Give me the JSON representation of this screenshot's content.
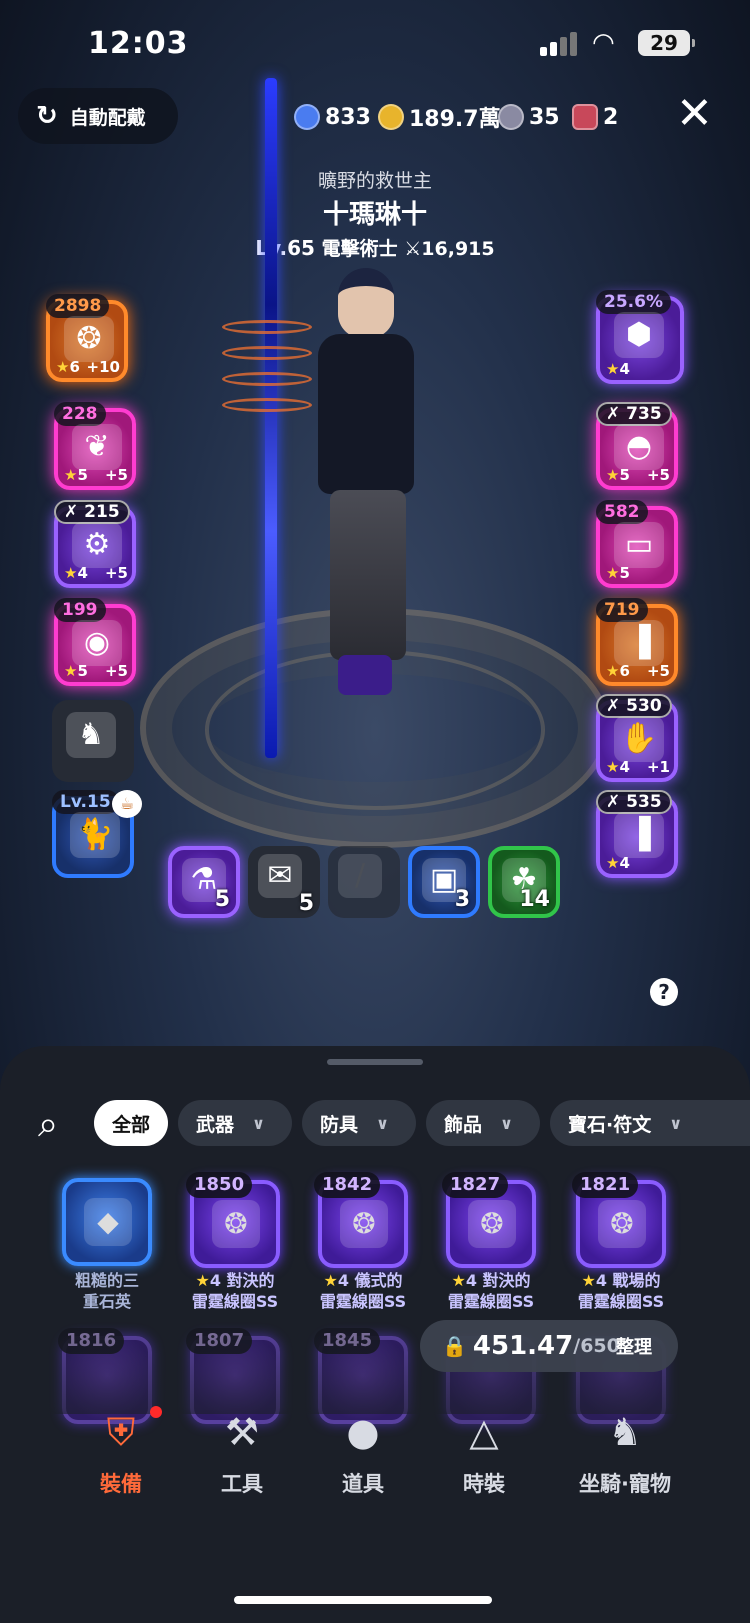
{
  "status_bar": {
    "time": "12:03",
    "battery": "29"
  },
  "top_bar": {
    "auto_equip_label": "自動配戴",
    "currencies": [
      {
        "icon": "blue-gem-icon",
        "value": "833",
        "color": "#5a8cff"
      },
      {
        "icon": "gold-coin-icon",
        "value": "189.7萬",
        "color": "#e8b42c"
      },
      {
        "icon": "silver-orb-icon",
        "value": "35",
        "color": "#a8a8c0"
      },
      {
        "icon": "demon-mask-icon",
        "value": "2",
        "color": "#d04050"
      }
    ],
    "close_label": "✕"
  },
  "character": {
    "title": "曠野的救世主",
    "name": "十瑪琳十",
    "level": "Lv.65",
    "class": "電擊術士",
    "power": "⚔16,915"
  },
  "left_slots": [
    {
      "badge": "2898",
      "stars": "6",
      "plus": "+10",
      "rarity": "orange",
      "icon": "claw-weapon-icon"
    },
    {
      "badge": "228",
      "stars": "5",
      "plus": "+5",
      "rarity": "pink",
      "icon": "necklace-icon"
    },
    {
      "badge": "✗ 215",
      "stars": "4",
      "plus": "+5",
      "rarity": "purple",
      "icon": "chain-necklace-icon"
    },
    {
      "badge": "199",
      "stars": "5",
      "plus": "+5",
      "rarity": "pink",
      "icon": "ring-icon"
    }
  ],
  "mount_slot": {
    "icon": "horse-icon"
  },
  "pet_slot": {
    "badge": "Lv.15",
    "icon": "cat-pet-icon"
  },
  "right_slots": [
    {
      "badge": "25.6%",
      "stars": "4",
      "plus": "",
      "rarity": "purple",
      "icon": "cube-icon"
    },
    {
      "badge": "✗ 735",
      "stars": "5",
      "plus": "+5",
      "rarity": "pink",
      "icon": "helmet-icon"
    },
    {
      "badge": "582",
      "stars": "5",
      "plus": "",
      "rarity": "pink",
      "icon": "armor-top-icon"
    },
    {
      "badge": "719",
      "stars": "6",
      "plus": "+5",
      "rarity": "orange",
      "icon": "armor-pants-icon"
    },
    {
      "badge": "✗ 530",
      "stars": "4",
      "plus": "+1",
      "rarity": "purple",
      "icon": "gloves-icon"
    },
    {
      "badge": "✗ 535",
      "stars": "4",
      "plus": "",
      "rarity": "purple",
      "icon": "boots-icon"
    }
  ],
  "quick_slots": [
    {
      "count": "5",
      "rarity": "purple",
      "icon": "red-potion-icon"
    },
    {
      "count": "5",
      "rarity": "dark",
      "icon": "scroll-icon"
    },
    {
      "count": "",
      "rarity": "dark",
      "icon": "empty-slot-icon"
    },
    {
      "count": "3",
      "rarity": "blue",
      "icon": "lantern-icon"
    },
    {
      "count": "14",
      "rarity": "green",
      "icon": "food-bag-icon"
    }
  ],
  "help_label": "?",
  "filter_chips": [
    {
      "label": "全部",
      "active": true
    },
    {
      "label": "武器",
      "active": false
    },
    {
      "label": "防具",
      "active": false
    },
    {
      "label": "飾品",
      "active": false
    },
    {
      "label": "寶石·符文",
      "active": false
    }
  ],
  "inventory_row1": [
    {
      "badge": "",
      "name1": "粗糙的三",
      "name2": "重石英",
      "star": "",
      "icon": "crystal-gem-icon",
      "rarity": "blue"
    },
    {
      "badge": "1850",
      "name1": "4 對決的",
      "name2": "雷霆線圈SS",
      "star": "★",
      "icon": "claw-weapon-icon",
      "rarity": "purple"
    },
    {
      "badge": "1842",
      "name1": "4 儀式的",
      "name2": "雷霆線圈SS",
      "star": "★",
      "icon": "claw-weapon-icon",
      "rarity": "purple"
    },
    {
      "badge": "1827",
      "name1": "4 對決的",
      "name2": "雷霆線圈SS",
      "star": "★",
      "icon": "claw-weapon-icon",
      "rarity": "purple"
    },
    {
      "badge": "1821",
      "name1": "4 戰場的",
      "name2": "雷霆線圈SS",
      "star": "★",
      "icon": "claw-weapon-icon",
      "rarity": "purple"
    }
  ],
  "inventory_row2": [
    {
      "badge": "1816"
    },
    {
      "badge": "1807"
    },
    {
      "badge": "1845"
    },
    {
      "badge": ""
    },
    {
      "badge": ""
    }
  ],
  "weight": {
    "current": "451.47",
    "max": "/650",
    "sort_label": "整理"
  },
  "bottom_nav": [
    {
      "label": "裝備",
      "icon": "shield-sword-icon",
      "active": true
    },
    {
      "label": "工具",
      "icon": "axe-icon",
      "active": false
    },
    {
      "label": "道具",
      "icon": "bag-icon",
      "active": false
    },
    {
      "label": "時裝",
      "icon": "hanger-icon",
      "active": false
    },
    {
      "label": "坐騎·寵物",
      "icon": "horse-head-icon",
      "active": false
    }
  ]
}
